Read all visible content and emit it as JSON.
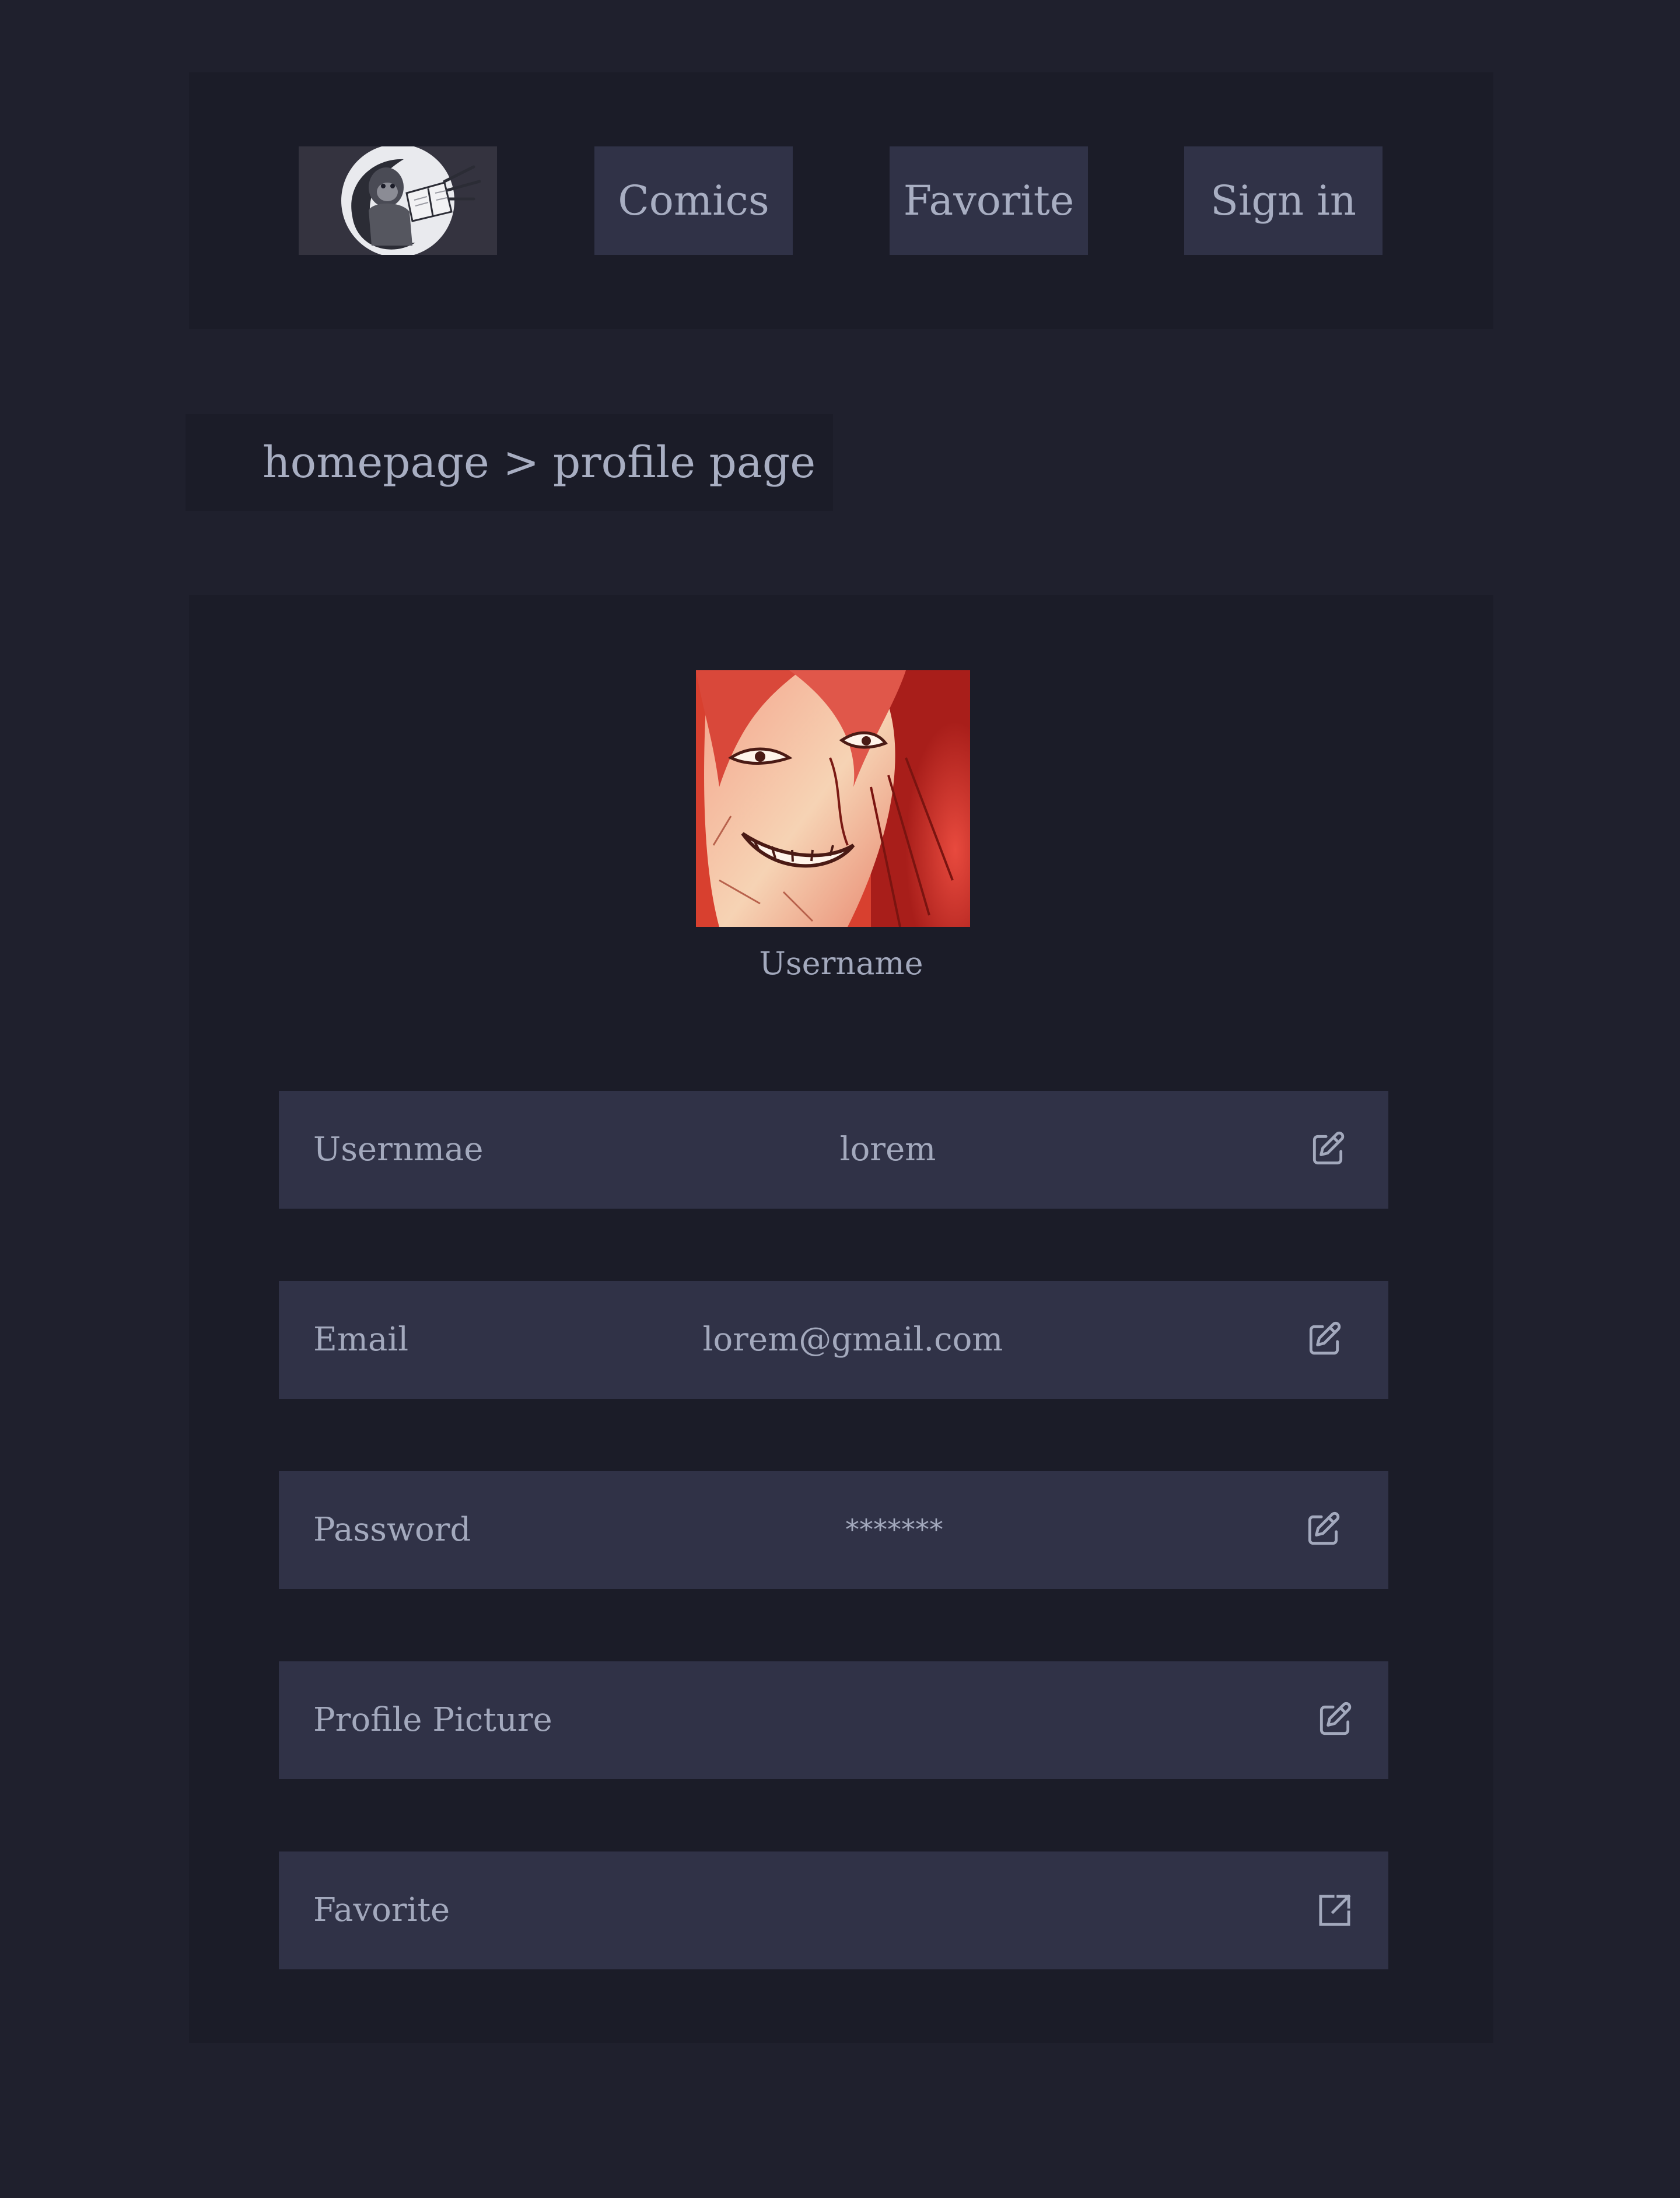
{
  "nav": {
    "logo_icon": "monkey-reading-book-logo",
    "items": [
      {
        "label": "Comics"
      },
      {
        "label": "Favorite"
      },
      {
        "label": "Sign in"
      }
    ]
  },
  "breadcrumb": {
    "text": "homepage > profile page"
  },
  "profile": {
    "avatar_icon": "manga-character-avatar",
    "display_name": "Username",
    "fields": [
      {
        "label": "Usernmae",
        "value": "lorem",
        "action_icon": "edit-icon"
      },
      {
        "label": "Email",
        "value": "lorem@gmail.com",
        "action_icon": "edit-icon"
      },
      {
        "label": "Password",
        "value": "*******",
        "action_icon": "edit-icon"
      },
      {
        "label": "Profile Picture",
        "value": "",
        "action_icon": "edit-icon"
      },
      {
        "label": "Favorite",
        "value": "",
        "action_icon": "external-link-icon"
      }
    ]
  },
  "colors": {
    "page_bg": "#1f202d",
    "panel_bg": "#1b1c28",
    "button_bg": "#303247",
    "text": "#a3a9bd"
  }
}
